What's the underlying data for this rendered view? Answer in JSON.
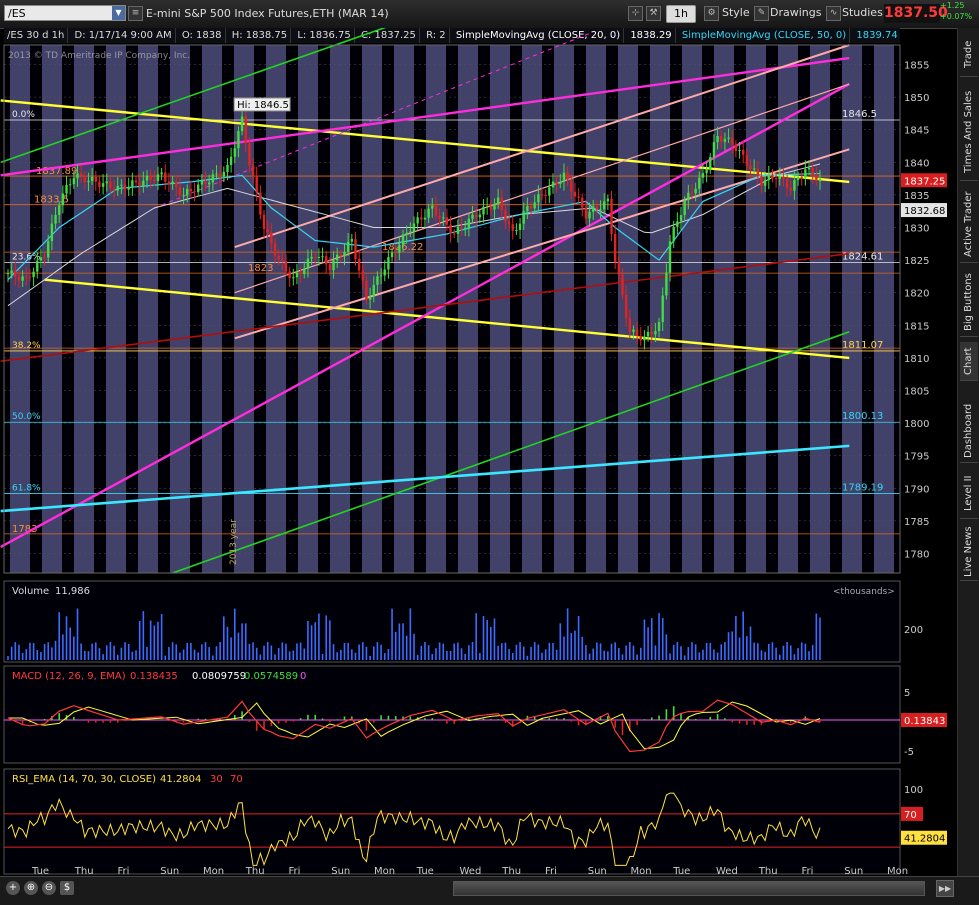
{
  "toolbar": {
    "symbol": "/ES",
    "instrument_title": "E-mini S&P 500 Index Futures,ETH (MAR 14)",
    "interval_label": "1h",
    "style_label": "Style",
    "drawings_label": "Drawings",
    "studies_label": "Studies",
    "last_price": "1837.50",
    "change_1": "+1.25",
    "change_2": "+0.07%"
  },
  "infobar": {
    "chart_id": "/ES 30 d 1h",
    "datetime": "D: 1/17/14 9:00 AM",
    "open": "O: 1838",
    "high": "H: 1838.75",
    "low": "L: 1836.75",
    "close": "C: 1837.25",
    "range": "R: 2",
    "sma20_label": "SimpleMovingAvg (CLOSE, 20, 0)",
    "sma20_value": "1838.29",
    "sma50_label": "SimpleMovingAvg (CLOSE, 50, 0)",
    "sma50_value": "1839.74"
  },
  "sidebar": {
    "tabs": [
      "Trade",
      "Times And Sales",
      "Active Trader",
      "Big Buttons",
      "Chart",
      "Dashboard",
      "Level II",
      "Live News"
    ]
  },
  "chart_data": [
    {
      "type": "candlestick",
      "panel": "price",
      "watermark": "2013 © TD Ameritrade IP Company, Inc.",
      "ylim": [
        1777,
        1858
      ],
      "yticks": [
        1780,
        1785,
        1790,
        1795,
        1800,
        1805,
        1810,
        1815,
        1820,
        1825,
        1830,
        1835,
        1840,
        1845,
        1850,
        1855
      ],
      "x_labels": [
        "Tue",
        "Thu",
        "Fri",
        "Sun",
        "Mon",
        "Thu",
        "Fri",
        "Sun",
        "Mon",
        "Tue",
        "Wed",
        "Thu",
        "Fri",
        "Sun",
        "Mon",
        "Tue",
        "Wed",
        "Thu",
        "Fri",
        "Sun",
        "Mon"
      ],
      "high_annotation": "Hi: 1846.5",
      "year_marker": "2013 year",
      "price_path": [
        [
          0,
          1823
        ],
        [
          5,
          1822
        ],
        [
          10,
          1826
        ],
        [
          14,
          1834
        ],
        [
          18,
          1838
        ],
        [
          24,
          1837
        ],
        [
          30,
          1836
        ],
        [
          36,
          1837
        ],
        [
          42,
          1838
        ],
        [
          48,
          1835
        ],
        [
          54,
          1837
        ],
        [
          60,
          1839
        ],
        [
          64,
          1846.5
        ],
        [
          66,
          1840
        ],
        [
          70,
          1830
        ],
        [
          74,
          1825
        ],
        [
          78,
          1822
        ],
        [
          84,
          1826
        ],
        [
          88,
          1824
        ],
        [
          94,
          1828
        ],
        [
          98,
          1819
        ],
        [
          104,
          1825
        ],
        [
          110,
          1830
        ],
        [
          116,
          1833
        ],
        [
          122,
          1829
        ],
        [
          128,
          1832
        ],
        [
          134,
          1834
        ],
        [
          138,
          1829
        ],
        [
          142,
          1833
        ],
        [
          148,
          1836
        ],
        [
          152,
          1838
        ],
        [
          158,
          1832
        ],
        [
          164,
          1834
        ],
        [
          166,
          1825
        ],
        [
          170,
          1814
        ],
        [
          174,
          1813
        ],
        [
          178,
          1815
        ],
        [
          181,
          1828
        ],
        [
          185,
          1834
        ],
        [
          190,
          1838
        ],
        [
          194,
          1844
        ],
        [
          198,
          1843
        ],
        [
          202,
          1840
        ],
        [
          206,
          1837
        ],
        [
          210,
          1838
        ],
        [
          214,
          1836
        ],
        [
          218,
          1839
        ],
        [
          222,
          1837.25
        ]
      ],
      "sma20": [
        [
          0,
          1822
        ],
        [
          14,
          1830
        ],
        [
          30,
          1836
        ],
        [
          50,
          1837
        ],
        [
          64,
          1838
        ],
        [
          72,
          1833
        ],
        [
          84,
          1828
        ],
        [
          100,
          1827
        ],
        [
          120,
          1829
        ],
        [
          140,
          1832
        ],
        [
          158,
          1834
        ],
        [
          166,
          1830
        ],
        [
          178,
          1825
        ],
        [
          190,
          1834
        ],
        [
          206,
          1838
        ],
        [
          222,
          1838.29
        ]
      ],
      "sma50": [
        [
          0,
          1818
        ],
        [
          20,
          1826
        ],
        [
          40,
          1833
        ],
        [
          60,
          1836
        ],
        [
          80,
          1833
        ],
        [
          100,
          1830
        ],
        [
          120,
          1830
        ],
        [
          140,
          1832
        ],
        [
          160,
          1833
        ],
        [
          175,
          1829
        ],
        [
          190,
          1832
        ],
        [
          210,
          1838
        ],
        [
          222,
          1839.74
        ]
      ],
      "price_labels": [
        {
          "text": "1837.89",
          "value": 1837.89,
          "color": "#ff8c3a"
        },
        {
          "text": "1833.5",
          "value": 1833.5,
          "color": "#ff8c3a"
        },
        {
          "text": "1826.22",
          "value": 1826.22,
          "color": "#ff8c3a"
        },
        {
          "text": "1823",
          "value": 1823,
          "color": "#ff8c3a"
        },
        {
          "text": "1783",
          "value": 1783,
          "color": "#ff8c3a"
        }
      ],
      "fib_levels": [
        {
          "label": "0.0%",
          "value": 1846.5,
          "right_label": "1846.5",
          "color": "#e8e8e8"
        },
        {
          "label": "23.6%",
          "value": 1824.61,
          "right_label": "1824.61",
          "color": "#e8e8e8"
        },
        {
          "label": "38.2%",
          "value": 1811.07,
          "right_label": "1811.07",
          "color": "#ffd94a"
        },
        {
          "label": "50.0%",
          "value": 1800.13,
          "right_label": "1800.13",
          "color": "#36d7f5"
        },
        {
          "label": "61.8%",
          "value": 1789.19,
          "right_label": "1789.19",
          "color": "#36d7f5"
        }
      ],
      "axis_badges": [
        {
          "text": "1837.25",
          "value": 1837.25,
          "bg": "#d81e1e",
          "fg": "#ffffff"
        },
        {
          "text": "1832.68",
          "value": 1832.68,
          "bg": "#e4e4e4",
          "fg": "#000000"
        }
      ]
    },
    {
      "type": "bar",
      "panel": "volume",
      "title": "Volume",
      "value_label": "11,986",
      "units": "<thousands>",
      "ytick": "200"
    },
    {
      "type": "line",
      "panel": "macd",
      "title": "MACD (12, 26, 9, EMA)",
      "values": [
        "0.138435",
        "0.0809759",
        "0.0574589",
        "0"
      ],
      "yticks": [
        "5",
        "-5"
      ],
      "axis_badge": "0.13843"
    },
    {
      "type": "line",
      "panel": "rsi",
      "title": "RSI_EMA (14, 70, 30, CLOSE)",
      "values": [
        "41.2804",
        "30",
        "70"
      ],
      "ytick": "100",
      "axis_badge_70": "70",
      "axis_badge_value": "41.2804"
    }
  ],
  "colors": {
    "panel_bg": "#000006",
    "session_band": "#4c4c7c",
    "session_dark": "#08083a",
    "up_candle": "#3fdd3f",
    "down_candle": "#e32222",
    "trend_yellow": "#ffff33",
    "trend_magenta": "#ff2cdc",
    "trend_pink": "#ffaaaa",
    "trend_green": "#22d422",
    "trend_cyan": "#3ae7ff",
    "trend_red": "#b40d0d"
  }
}
